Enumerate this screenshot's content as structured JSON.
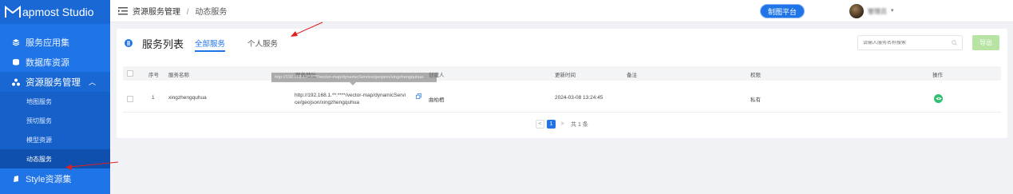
{
  "app": {
    "logo_letter": "M",
    "logo_text": "apmost Studio"
  },
  "sidebar": {
    "items": [
      {
        "label": "服务应用集",
        "icon": "layers-icon"
      },
      {
        "label": "数据库资源",
        "icon": "database-icon"
      },
      {
        "label": "资源服务管理",
        "icon": "cluster-icon",
        "expanded": true
      }
    ],
    "sub_items": [
      {
        "label": "地图服务"
      },
      {
        "label": "预切服务"
      },
      {
        "label": "模型资源"
      },
      {
        "label": "动态服务",
        "active": true
      }
    ],
    "bottom_item": {
      "label": "Style资源集",
      "icon": "style-icon"
    }
  },
  "topbar": {
    "breadcrumb": [
      "资源服务管理",
      "动态服务"
    ],
    "separator": "/",
    "platform_button": "制图平台",
    "user_name": "管理员"
  },
  "card": {
    "title": "服务列表",
    "tabs": [
      {
        "label": "全部服务",
        "active": true
      },
      {
        "label": "个人服务",
        "active": false
      }
    ],
    "search_placeholder": "请输入服务名称搜索",
    "export_label": "导出"
  },
  "table": {
    "columns": [
      "序号",
      "服务名称",
      "服务地址",
      "创建人",
      "更新时间",
      "备注",
      "权限",
      "操作"
    ],
    "rows": [
      {
        "index": "1",
        "name": "xingzhengquhua",
        "address_line1": "http://192.168.1.**:****/vector-map/dynamicServi",
        "address_line2": "ce/geojson/xingzhengquhua",
        "creator": "曲柏栖",
        "updated": "2024-03-08 13:24:45",
        "note": "",
        "permission": "私有"
      }
    ],
    "tooltip": "http://192.168.1.**:****/vector-map/dynamicService/geojson/xingzhengquhua"
  },
  "pagination": {
    "current": "1",
    "prev": "<",
    "next": ">",
    "total_text": "共 1 条"
  },
  "colors": {
    "sidebar": "#1f74e8",
    "accent": "#1f74e8",
    "export": "#b7e4a3",
    "view_button": "#2fbf71",
    "annotation": "#e02020"
  }
}
